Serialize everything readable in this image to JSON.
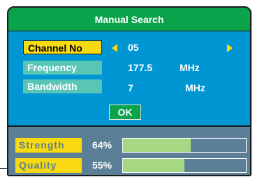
{
  "title": "Manual Search",
  "rows": {
    "channel": {
      "label": "Channel No",
      "value": "05"
    },
    "frequency": {
      "label": "Frequency",
      "value": "177.5",
      "unit": "MHz"
    },
    "bandwidth": {
      "label": "Bandwidth",
      "value": "7",
      "unit": "MHz"
    }
  },
  "ok_label": "OK",
  "meters": {
    "strength": {
      "label": "Strength",
      "value_text": "64%",
      "level": 0.55
    },
    "quality": {
      "label": "Quality",
      "value_text": "55%",
      "level": 0.5
    }
  },
  "colors": {
    "title_bar": "#0aa24a",
    "panel": "#0096d4",
    "selected_label": "#f9d90f",
    "normal_label": "#59c5b5",
    "meter_area": "#5a7f96",
    "meter_fill": "#a6d783"
  }
}
